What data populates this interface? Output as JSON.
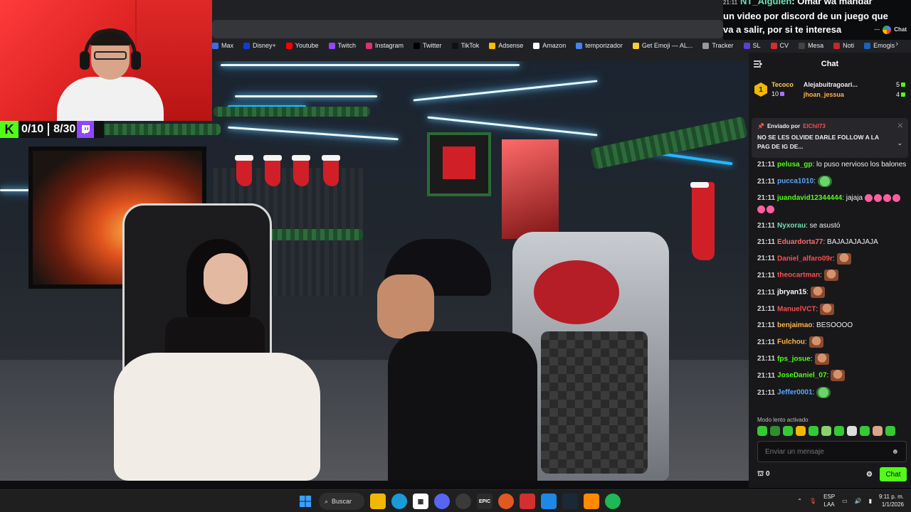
{
  "bookmarks": [
    {
      "label": "Max",
      "icon": "max-icon",
      "color": "#3a6df0"
    },
    {
      "label": "Disney+",
      "icon": "disney-icon",
      "color": "#113ccf"
    },
    {
      "label": "Youtube",
      "icon": "youtube-icon",
      "color": "#ff0000"
    },
    {
      "label": "Twitch",
      "icon": "twitch-icon",
      "color": "#9146ff"
    },
    {
      "label": "Instagram",
      "icon": "instagram-icon",
      "color": "#e1306c"
    },
    {
      "label": "Twitter",
      "icon": "x-icon",
      "color": "#000000"
    },
    {
      "label": "TikTok",
      "icon": "tiktok-icon",
      "color": "#111111"
    },
    {
      "label": "Adsense",
      "icon": "adsense-icon",
      "color": "#fbbc04"
    },
    {
      "label": "Amazon",
      "icon": "amazon-icon",
      "color": "#ffffff"
    },
    {
      "label": "temporizador",
      "icon": "timer-icon",
      "color": "#4285f4"
    },
    {
      "label": "Get Emoji — AL...",
      "icon": "emoji-icon",
      "color": "#ffcc33"
    },
    {
      "label": "Tracker",
      "icon": "tracker-icon",
      "color": "#999999"
    },
    {
      "label": "SL",
      "icon": "sl-icon",
      "color": "#5b3fd6"
    },
    {
      "label": "CV",
      "icon": "cv-icon",
      "color": "#d32f2f"
    },
    {
      "label": "Mesa",
      "icon": "mesa-icon",
      "color": "#444444"
    },
    {
      "label": "Noti",
      "icon": "noti-icon",
      "color": "#c62828"
    },
    {
      "label": "Emogis",
      "icon": "emogis-icon",
      "color": "#1565c0"
    }
  ],
  "overlay": {
    "timestamp": "21:11",
    "user": "NT_Alguien",
    "lines": [
      "un video por discord de un juego que",
      "va a salir, por si te interesa"
    ],
    "first_line_tail": ": Omar wa mandar",
    "side_label": "Chat"
  },
  "counter": {
    "kick_logo": "K",
    "kick_count": "0/10",
    "twitch_count": "8/30"
  },
  "chat": {
    "title": "Chat",
    "leaderboard": {
      "top": {
        "rank": "1",
        "name": "Tecoco",
        "value": "10"
      },
      "second": {
        "name": "Alejabuitragoari...",
        "value": "5"
      },
      "third": {
        "name": "jhoan_jessua",
        "value": "4"
      }
    },
    "pinned": {
      "sent_by_label": "Enviado por",
      "sender": "ElChil73",
      "text": "NO SE LES OLVIDE DARLE FOLLOW A LA PAG DE IG DE..."
    },
    "messages": [
      {
        "ts": "21:11",
        "user": "pelusa_gp",
        "color": "#53fc18",
        "text": " lo puso nervioso los balones",
        "emote": ""
      },
      {
        "ts": "21:11",
        "user": "pucca1010",
        "color": "#59a8ff",
        "text": "",
        "emote": "frog"
      },
      {
        "ts": "21:11",
        "user": "juandavid12344444",
        "color": "#53fc18",
        "text": " jajaja",
        "emote": "laugh"
      },
      {
        "ts": "21:11",
        "user": "Nyxorau",
        "color": "#6fe0b0",
        "text": " se asustó",
        "emote": ""
      },
      {
        "ts": "21:11",
        "user": "Eduardorta77",
        "color": "#ff6b6b",
        "text": " BAJAJAJAJAJA",
        "emote": ""
      },
      {
        "ts": "21:11",
        "user": "Daniel_alfaro09r",
        "color": "#ff4d4d",
        "text": "",
        "emote": "face"
      },
      {
        "ts": "21:11",
        "user": "theocartman",
        "color": "#ff4d4d",
        "text": "",
        "emote": "face"
      },
      {
        "ts": "21:11",
        "user": "jbryan15",
        "color": "#ffffff",
        "text": "",
        "emote": "face"
      },
      {
        "ts": "21:11",
        "user": "ManuelVCT",
        "color": "#ff4d4d",
        "text": "",
        "emote": "face"
      },
      {
        "ts": "21:11",
        "user": "benjaimao",
        "color": "#ffb547",
        "text": " BESOOOO",
        "emote": ""
      },
      {
        "ts": "21:11",
        "user": "Fulchou",
        "color": "#ffb547",
        "text": "",
        "emote": "face"
      },
      {
        "ts": "21:11",
        "user": "fps_josue",
        "color": "#53fc18",
        "text": "",
        "emote": "face"
      },
      {
        "ts": "21:11",
        "user": "JoseDaniel_07",
        "color": "#53fc18",
        "text": "",
        "emote": "face"
      },
      {
        "ts": "21:11",
        "user": "Jeffer0001",
        "color": "#59a8ff",
        "text": "",
        "emote": "frog"
      }
    ],
    "slow_mode": "Modo lento activado",
    "input_placeholder": "Enviar un mensaje",
    "points": "0",
    "send_label": "Chat"
  },
  "taskbar": {
    "search_label": "Buscar",
    "lang_top": "ESP",
    "lang_bottom": "LAA",
    "time": "9:11 p. m.",
    "date": "1/1/2026"
  },
  "colors": {
    "kick_green": "#53fc18",
    "twitch_purple": "#9146ff"
  }
}
